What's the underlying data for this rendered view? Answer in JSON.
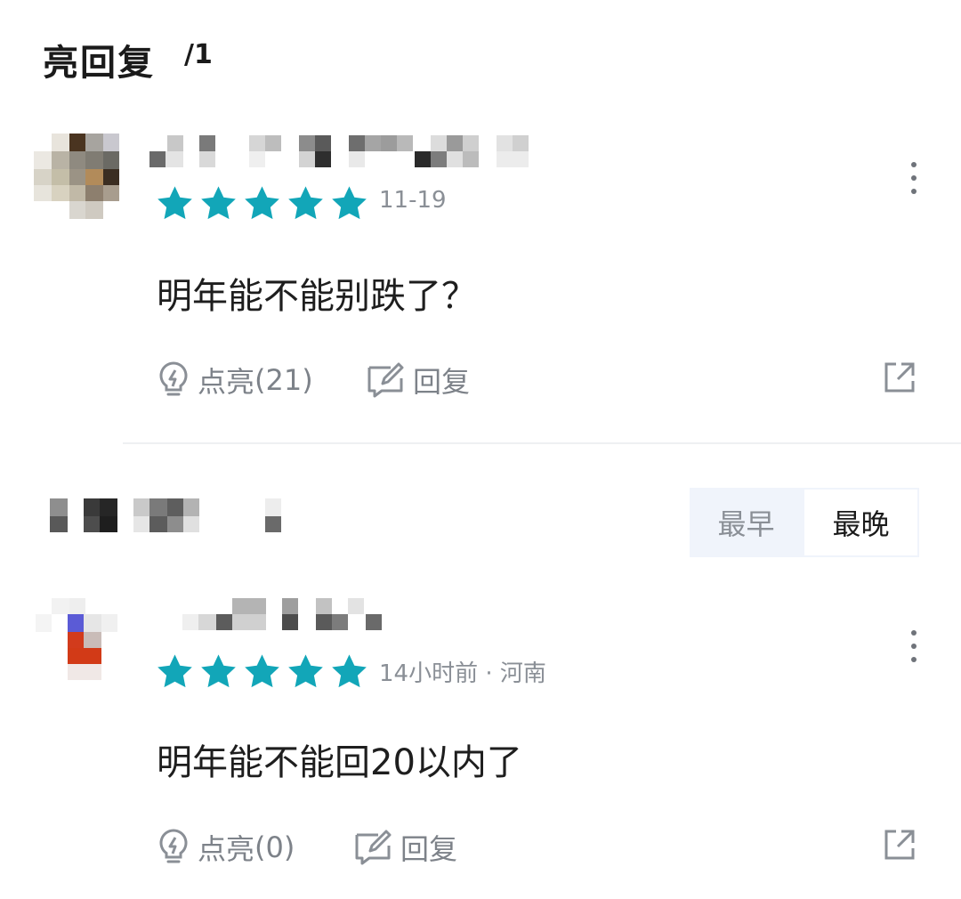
{
  "header": {
    "title": "亮回复",
    "count": "/1"
  },
  "sort": {
    "earliest": "最早",
    "latest": "最晚",
    "selected": "最晚"
  },
  "actions": {
    "like_label": "点亮",
    "reply_label": "回复"
  },
  "colors": {
    "star": "#12a6b8",
    "text_secondary": "#8a8f96",
    "sort_bg": "#f0f4fb"
  },
  "icons": [
    "star-icon",
    "more-vertical-icon",
    "lightbulb-icon",
    "edit-reply-icon",
    "share-icon"
  ],
  "replies": [
    {
      "rating": 5,
      "meta": "11-19",
      "content": "明年能不能别跌了？",
      "like_count": "(21)"
    },
    {
      "rating": 5,
      "meta": "14小时前 · 河南",
      "content": "明年能不能回20以内了",
      "like_count": "(0)"
    }
  ]
}
